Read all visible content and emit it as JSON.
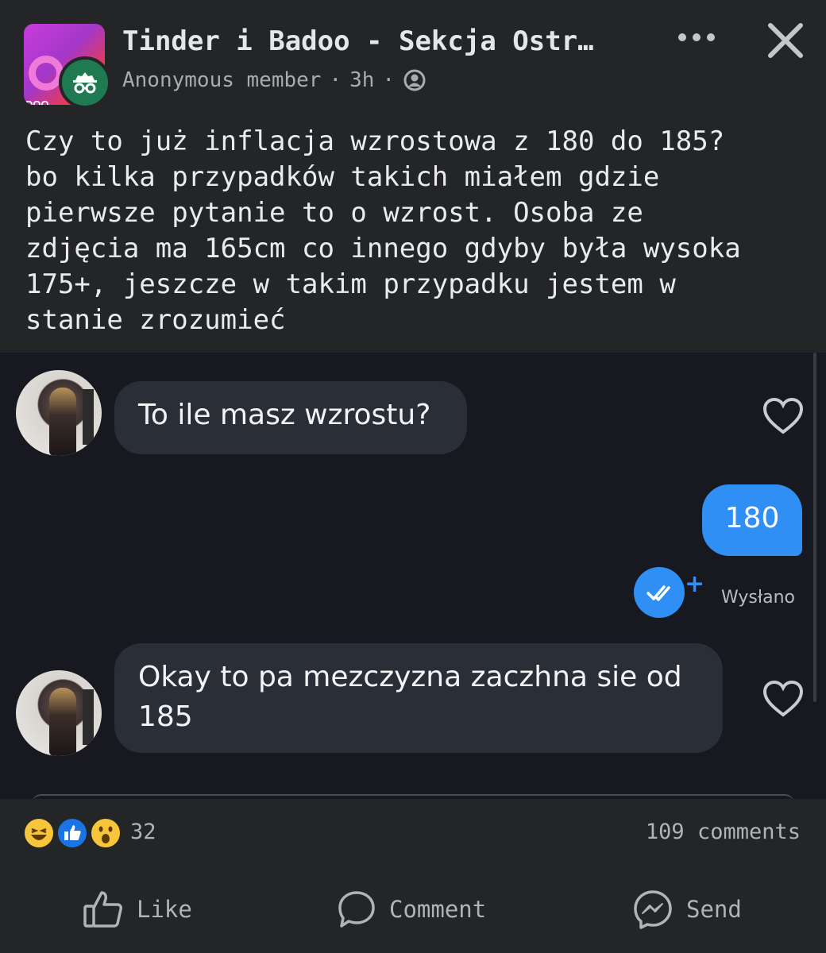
{
  "header": {
    "group_name": "Tinder i Badoo - Sekcja Ostr…",
    "group_avatar_text": "DOO",
    "author": "Anonymous member",
    "separator": "·",
    "time": "3h",
    "privacy_icon": "group-privacy-icon",
    "more_icon": "more-dots-icon",
    "close_icon": "close-icon"
  },
  "post": {
    "text": "Czy to już inflacja wzrostowa z 180 do 185?\nbo kilka przypadków takich miałem gdzie\npierwsze pytanie to o wzrost. Osoba ze\nzdjęcia ma 165cm co innego gdyby była wysoka\n175+, jeszcze w takim przypadku jestem w\nstanie zrozumieć"
  },
  "chat": {
    "messages": [
      {
        "from": "them",
        "text": "To ile masz wzrostu?"
      },
      {
        "from": "me",
        "text": "180",
        "status": "Wysłano"
      },
      {
        "from": "them",
        "text": "Okay to pa mezczyzna zaczhna sie od\n185"
      }
    ],
    "sent_plus": "+"
  },
  "stats": {
    "reactions": [
      "haha",
      "like",
      "wow"
    ],
    "reaction_count": "32",
    "comments": "109 comments"
  },
  "actions": {
    "like": "Like",
    "comment": "Comment",
    "send": "Send"
  },
  "colors": {
    "background": "#242526",
    "chat_background": "#181920",
    "incoming_bubble": "#2a2e37",
    "outgoing_bubble": "#2f8ff5",
    "anon_badge": "#1f7a52",
    "like_blue": "#1b74e4"
  }
}
